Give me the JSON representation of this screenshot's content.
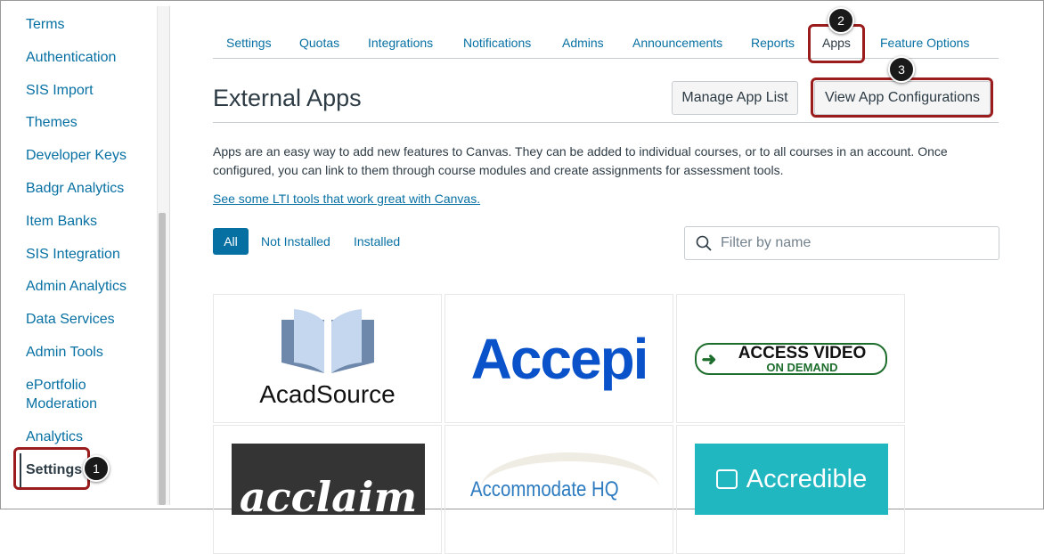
{
  "sidebar": {
    "items": [
      "Terms",
      "Authentication",
      "SIS Import",
      "Themes",
      "Developer Keys",
      "Badgr Analytics",
      "Item Banks",
      "SIS Integration",
      "Admin Analytics",
      "Data Services",
      "Admin Tools",
      "ePortfolio Moderation",
      "Analytics",
      "Settings"
    ]
  },
  "tabs": [
    "Settings",
    "Quotas",
    "Integrations",
    "Notifications",
    "Admins",
    "Announcements",
    "Reports",
    "Apps",
    "Feature Options"
  ],
  "header": {
    "title": "External Apps",
    "manage_label": "Manage App List",
    "view_config_label": "View App Configurations"
  },
  "description": "Apps are an easy way to add new features to Canvas. They can be added to individual courses, or to all courses in an account. Once configured, you can link to them through course modules and create assignments for assessment tools.",
  "lti_link": "See some LTI tools that work great with Canvas.",
  "filters": [
    "All",
    "Not Installed",
    "Installed"
  ],
  "search": {
    "placeholder": "Filter by name"
  },
  "apps": [
    "AcadSource",
    "Accepi",
    "ACCESS VIDEO",
    "ON DEMAND",
    "acclaim",
    "Accommodate HQ",
    "Accredible"
  ],
  "callouts": [
    "1",
    "2",
    "3"
  ]
}
